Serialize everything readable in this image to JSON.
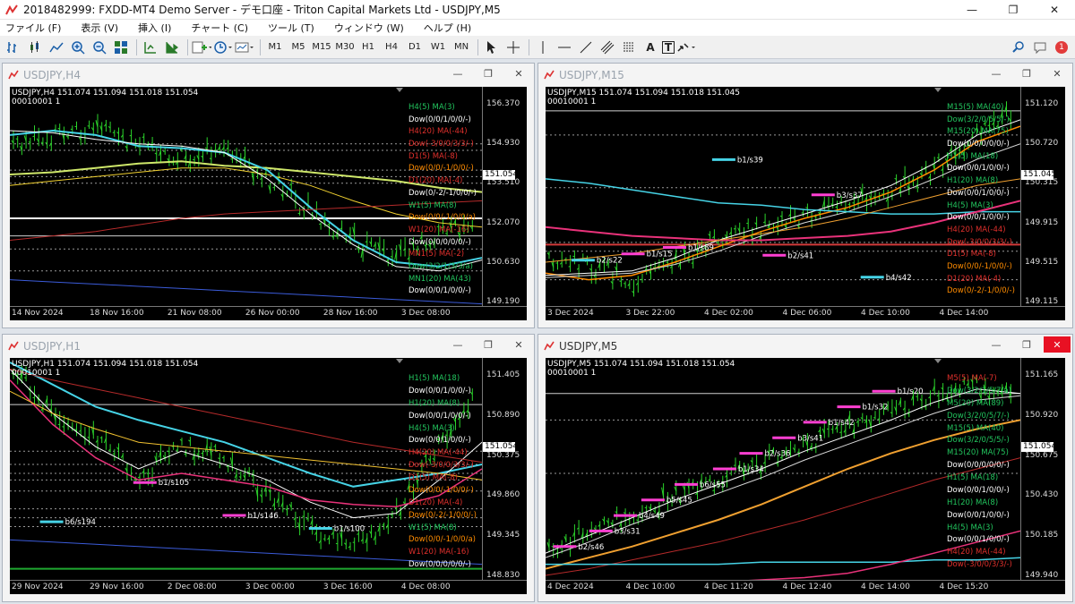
{
  "app": {
    "title": "2018482999: FXDD-MT4 Demo Server - デモ口座 - Triton Capital Markets Ltd - USDJPY,M5",
    "icon": "mt4-logo-icon",
    "controls": {
      "minimize": "—",
      "maximize": "❐",
      "close": "✕"
    }
  },
  "menu": [
    "ファイル (F)",
    "表示 (V)",
    "挿入 (I)",
    "チャート (C)",
    "ツール (T)",
    "ウィンドウ (W)",
    "ヘルプ (H)"
  ],
  "toolbar": {
    "timeframes": [
      "M1",
      "M5",
      "M15",
      "M30",
      "H1",
      "H4",
      "D1",
      "W1",
      "MN"
    ],
    "tools_text": [
      "A",
      "T"
    ],
    "notification_count": "1"
  },
  "charts": [
    {
      "id": "h4",
      "window_title": "USDJPY,H4",
      "active": false,
      "header": "USDJPY,H4  151.074 151.094 151.018 151.054",
      "header2": "00010001 1",
      "prices": [
        "156.370",
        "154.930",
        "153.510",
        "152.070",
        "150.630",
        "149.190"
      ],
      "current_price": "151.054",
      "times": [
        "14 Nov 2024",
        "18 Nov 16:00",
        "21 Nov 08:00",
        "26 Nov 00:00",
        "28 Nov 16:00",
        "3 Dec 08:00"
      ],
      "labels": [
        {
          "t": "H4(5) MA(3)",
          "c": "#22c55e"
        },
        {
          "t": "Dow(0/0/1/0/0/-)",
          "c": "#ffffff"
        },
        {
          "t": "H4(20) MA(-44)",
          "c": "#e0302c"
        },
        {
          "t": "Dow(-3/0/0/3/3/-)",
          "c": "#e0302c"
        },
        {
          "t": "D1(5) MA(-8)",
          "c": "#e0302c"
        },
        {
          "t": "Dow(0/0/-1/0/0/-)",
          "c": "#ff8c00"
        },
        {
          "t": "D1(20) MA(-4)",
          "c": "#e0302c"
        },
        {
          "t": "Dow(0/-2/-1/0/0/-)",
          "c": "#ffffff"
        },
        {
          "t": "W1(5) MA(8)",
          "c": "#22c55e"
        },
        {
          "t": "Dow(0/0/-1/0/0/a)",
          "c": "#ff8c00"
        },
        {
          "t": "W1(20) MA(-16)",
          "c": "#e0302c"
        },
        {
          "t": "Dow(0/0/0/0/0/-)",
          "c": "#ffffff"
        },
        {
          "t": "MN1(5) MA(-2)",
          "c": "#e0302c"
        },
        {
          "t": "Dow(3/2/1/3/3/a)",
          "c": "#22c55e"
        },
        {
          "t": "MN1(20) MA(43)",
          "c": "#22c55e"
        },
        {
          "t": "Dow(0/0/1/0/0/-)",
          "c": "#ffffff"
        }
      ],
      "marks": []
    },
    {
      "id": "m15",
      "window_title": "USDJPY,M15",
      "active": false,
      "header": "USDJPY,M15  151.074 151.094 151.018 151.045",
      "header2": "00010001 1",
      "prices": [
        "151.120",
        "150.720",
        "150.315",
        "149.915",
        "149.515",
        "149.115"
      ],
      "current_price": "151.045",
      "times": [
        "3 Dec 2024",
        "3 Dec 22:00",
        "4 Dec 02:00",
        "4 Dec 06:00",
        "4 Dec 10:00",
        "4 Dec 14:00"
      ],
      "labels": [
        {
          "t": "M15(5) MA(40)",
          "c": "#22c55e"
        },
        {
          "t": "Dow(3/2/0/5/5/-)",
          "c": "#22c55e"
        },
        {
          "t": "M15(20) MA(75)",
          "c": "#22c55e"
        },
        {
          "t": "Dow(0/0/0/0/0/-)",
          "c": "#ffffff"
        },
        {
          "t": "H1(5) MA(18)",
          "c": "#22c55e"
        },
        {
          "t": "Dow(0/0/1/0/0/-)",
          "c": "#ffffff"
        },
        {
          "t": "H1(20) MA(8)",
          "c": "#22c55e"
        },
        {
          "t": "Dow(0/0/1/0/0/-)",
          "c": "#ffffff"
        },
        {
          "t": "H4(5) MA(3)",
          "c": "#22c55e"
        },
        {
          "t": "Dow(0/0/1/0/0/-)",
          "c": "#ffffff"
        },
        {
          "t": "H4(20) MA(-44)",
          "c": "#e0302c"
        },
        {
          "t": "Dow(-3/0/0/3/3/-)",
          "c": "#e0302c"
        },
        {
          "t": "D1(5) MA(-8)",
          "c": "#e0302c"
        },
        {
          "t": "Dow(0/0/-1/0/0/-)",
          "c": "#ff8c00"
        },
        {
          "t": "D1(20) MA(-4)",
          "c": "#e0302c"
        },
        {
          "t": "Dow(0/-2/-1/0/0/-)",
          "c": "#ff8c00"
        }
      ],
      "marks": [
        "b2/s22",
        "b1/s15",
        "b1/s89",
        "b1/s39",
        "b2/s41",
        "b3/s37",
        "b4/s42"
      ]
    },
    {
      "id": "h1",
      "window_title": "USDJPY,H1",
      "active": false,
      "header": "USDJPY,H1  151.074 151.094 151.018 151.054",
      "header2": "00010001 1",
      "prices": [
        "151.405",
        "150.890",
        "150.375",
        "149.860",
        "149.345",
        "148.830"
      ],
      "current_price": "151.054",
      "times": [
        "29 Nov 2024",
        "29 Nov 16:00",
        "2 Dec 08:00",
        "3 Dec 00:00",
        "3 Dec 16:00",
        "4 Dec 08:00"
      ],
      "labels": [
        {
          "t": "H1(5) MA(18)",
          "c": "#22c55e"
        },
        {
          "t": "Dow(0/0/1/0/0/-)",
          "c": "#ffffff"
        },
        {
          "t": "H1(20) MA(8)",
          "c": "#22c55e"
        },
        {
          "t": "Dow(0/0/1/0/0/-)",
          "c": "#ffffff"
        },
        {
          "t": "H4(5) MA(3)",
          "c": "#22c55e"
        },
        {
          "t": "Dow(0/0/1/0/0/-)",
          "c": "#ffffff"
        },
        {
          "t": "H4(20) MA(-44)",
          "c": "#e0302c"
        },
        {
          "t": "Dow(-3/0/0/3/3/-)",
          "c": "#e0302c"
        },
        {
          "t": "D1(5) MA(-8)",
          "c": "#e0302c"
        },
        {
          "t": "Dow(0/0/-1/0/0/-)",
          "c": "#ff8c00"
        },
        {
          "t": "D1(20) MA(-4)",
          "c": "#e0302c"
        },
        {
          "t": "Dow(0/-2/-1/0/0/-)",
          "c": "#ff8c00"
        },
        {
          "t": "W1(5) MA(8)",
          "c": "#22c55e"
        },
        {
          "t": "Dow(0/0/-1/0/0/a)",
          "c": "#ff8c00"
        },
        {
          "t": "W1(20) MA(-16)",
          "c": "#e0302c"
        },
        {
          "t": "Dow(0/0/0/0/0/-)",
          "c": "#ffffff"
        }
      ],
      "marks": [
        "b6/s194",
        "b1/s105",
        "b1/s146",
        "b1/s100"
      ]
    },
    {
      "id": "m5",
      "window_title": "USDJPY,M5",
      "active": true,
      "header": "USDJPY,M5  151.074 151.094 151.018 151.054",
      "header2": "00010001 1",
      "prices": [
        "151.165",
        "150.920",
        "150.675",
        "150.430",
        "150.185",
        "149.940"
      ],
      "current_price": "151.054",
      "times": [
        "4 Dec 2024",
        "4 Dec 10:00",
        "4 Dec 11:20",
        "4 Dec 12:40",
        "4 Dec 14:00",
        "4 Dec 15:20"
      ],
      "labels": [
        {
          "t": "M5(5) MA(-7)",
          "c": "#e0302c"
        },
        {
          "t": "Dow(3/2/1/5/7/a)",
          "c": "#22c55e"
        },
        {
          "t": "M5(20) MA(89)",
          "c": "#22c55e"
        },
        {
          "t": "Dow(3/2/0/5/7/-)",
          "c": "#22c55e"
        },
        {
          "t": "M15(5) MA(40)",
          "c": "#22c55e"
        },
        {
          "t": "Dow(3/2/0/5/5/-)",
          "c": "#22c55e"
        },
        {
          "t": "M15(20) MA(75)",
          "c": "#22c55e"
        },
        {
          "t": "Dow(0/0/0/0/0/-)",
          "c": "#ffffff"
        },
        {
          "t": "H1(5) MA(18)",
          "c": "#22c55e"
        },
        {
          "t": "Dow(0/0/1/0/0/-)",
          "c": "#ffffff"
        },
        {
          "t": "H1(20) MA(8)",
          "c": "#22c55e"
        },
        {
          "t": "Dow(0/0/1/0/0/-)",
          "c": "#ffffff"
        },
        {
          "t": "H4(5) MA(3)",
          "c": "#22c55e"
        },
        {
          "t": "Dow(0/0/1/0/0/-)",
          "c": "#ffffff"
        },
        {
          "t": "H4(20) MA(-44)",
          "c": "#e0302c"
        },
        {
          "t": "Dow(-3/0/0/3/3/-)",
          "c": "#e0302c"
        }
      ],
      "marks": [
        "b2/s46",
        "b3/s31",
        "b4/s49",
        "b5/s45",
        "b6/s55",
        "b1/s34",
        "b2/s36",
        "b3/s41",
        "b1/s42",
        "b1/s32",
        "b1/s20"
      ]
    }
  ]
}
